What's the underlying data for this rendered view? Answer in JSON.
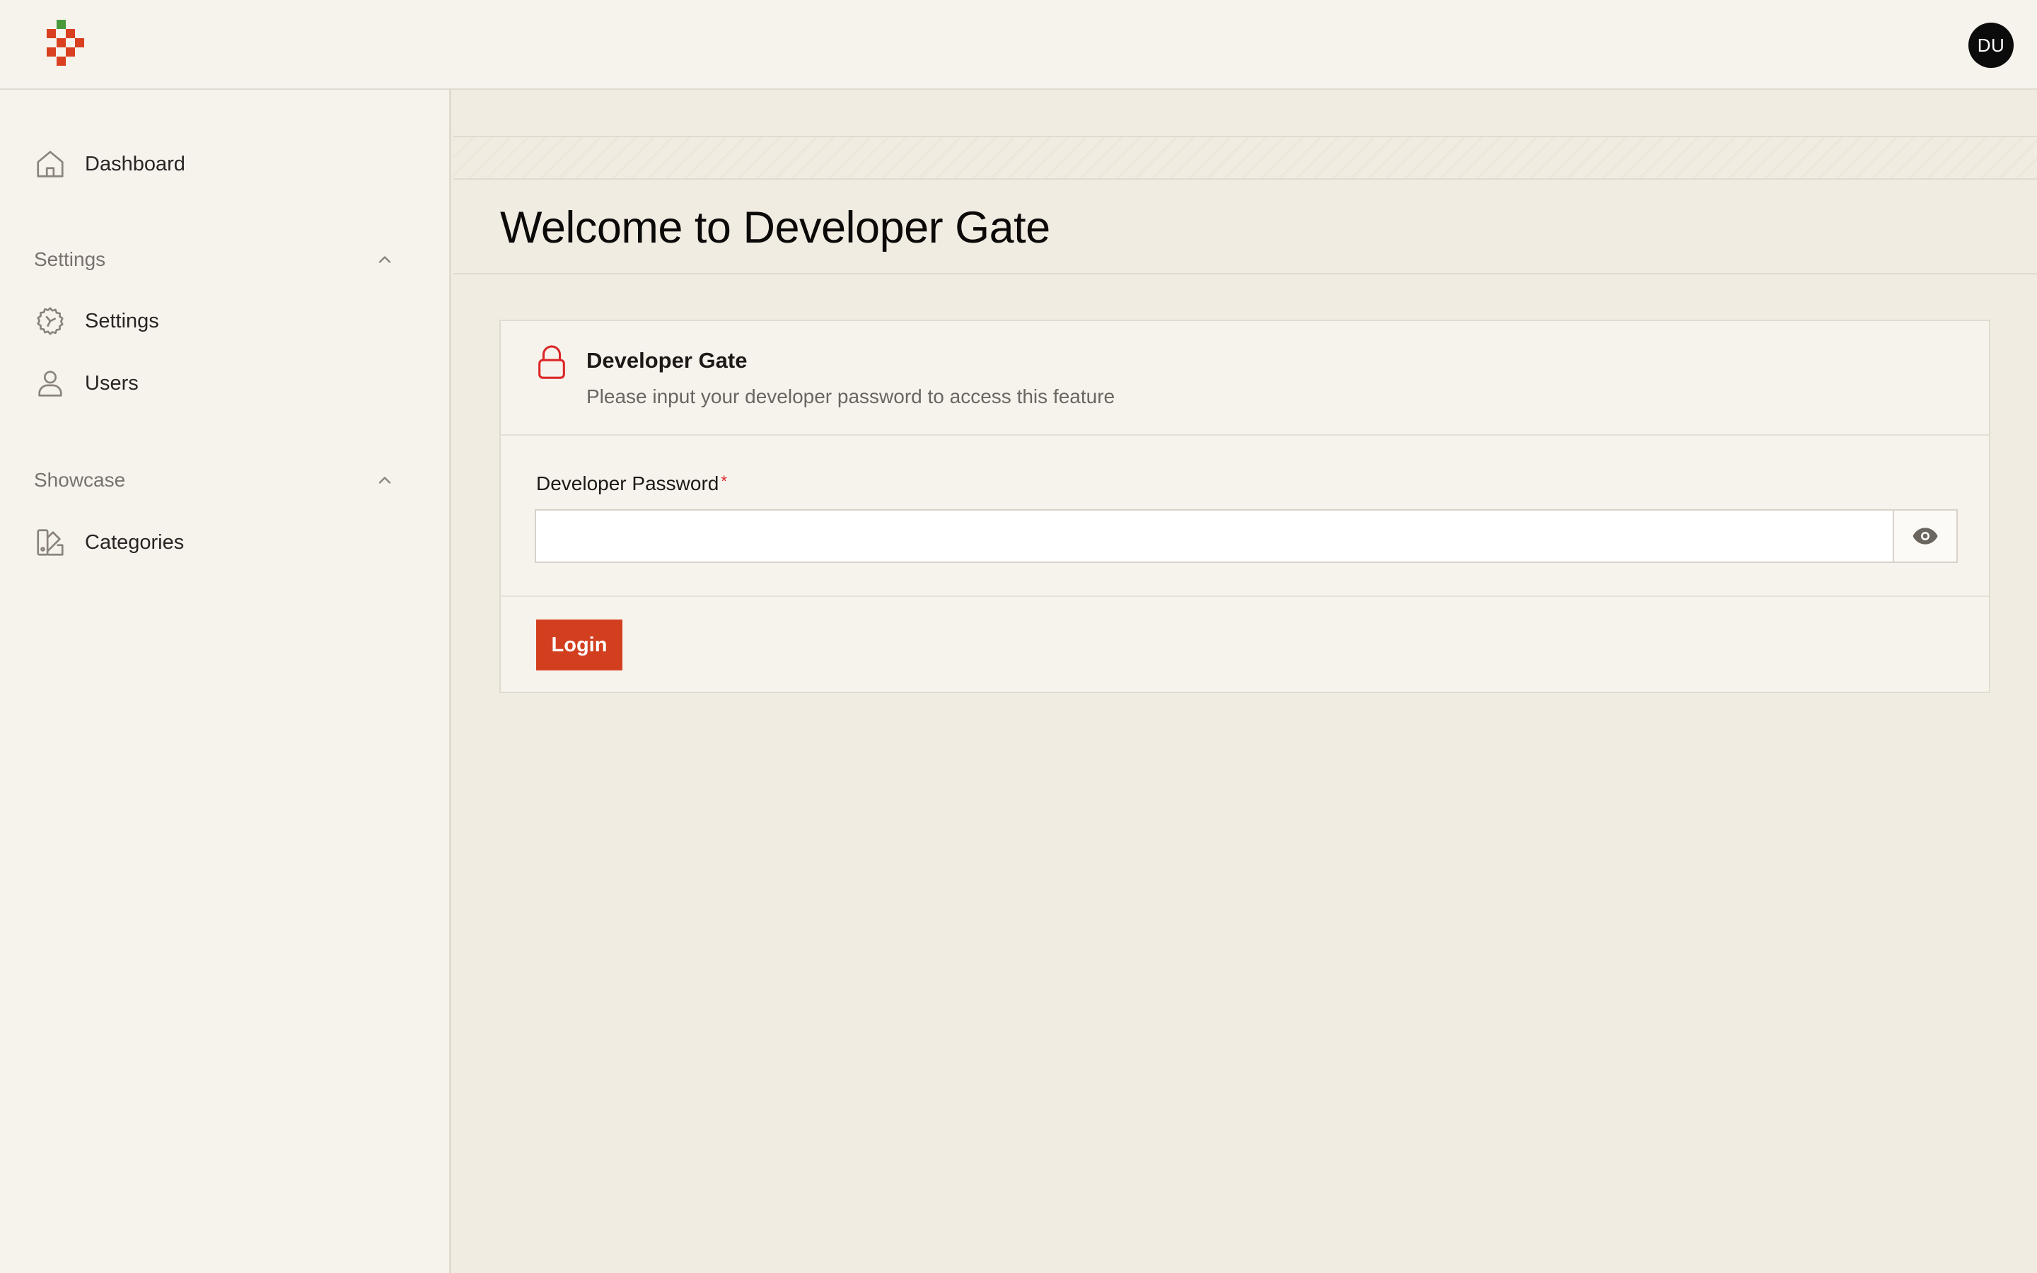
{
  "header": {
    "avatar_initials": "DU",
    "logo_colors": {
      "green": "#4a9a3c",
      "red": "#d9401f"
    }
  },
  "sidebar": {
    "dashboard": {
      "label": "Dashboard",
      "icon": "home-icon"
    },
    "groups": [
      {
        "label": "Settings",
        "expanded": true,
        "items": [
          {
            "label": "Settings",
            "icon": "gear-icon"
          },
          {
            "label": "Users",
            "icon": "user-icon"
          }
        ]
      },
      {
        "label": "Showcase",
        "expanded": true,
        "items": [
          {
            "label": "Categories",
            "icon": "swatch-icon"
          }
        ]
      }
    ]
  },
  "main": {
    "title": "Welcome to Developer Gate",
    "card": {
      "title": "Developer Gate",
      "description": "Please input your developer password to access this feature",
      "icon": "lock-icon",
      "field_label": "Developer Password",
      "required_marker": "*",
      "password_value": "",
      "password_placeholder": "",
      "toggle_icon": "eye-icon",
      "submit_label": "Login"
    }
  },
  "colors": {
    "accent": "#d23f1f",
    "lock_icon": "#dc2626",
    "sidebar_bg": "#f6f3ed",
    "main_bg": "#f0ece2",
    "avatar_bg": "#0b0b0b"
  }
}
